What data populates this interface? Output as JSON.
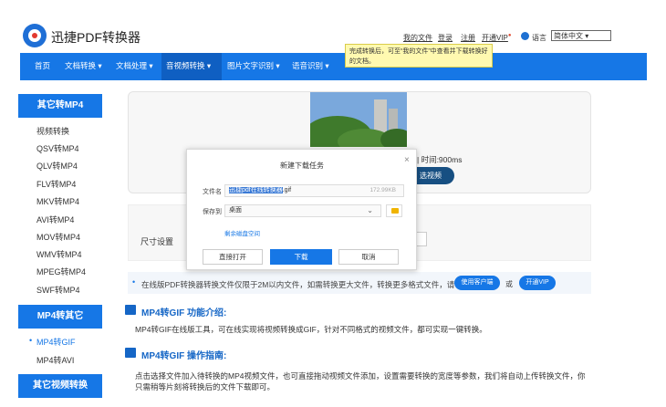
{
  "brand": {
    "name": "迅捷PDF转换器"
  },
  "toplinks": {
    "my_files": "我的文件",
    "login": "登录",
    "register": "注册",
    "open_vip": "开通VIP",
    "vip_badge": "●",
    "language": "语言",
    "lang_value": "简体中文 ▾"
  },
  "tooltip": {
    "text": "完成转换后，可至“我的文件”中查看并下载转换好的文档。"
  },
  "nav": {
    "items": [
      "首页",
      "文档转换 ▾",
      "文档处理 ▾",
      "音视频转换 ▾",
      "图片文字识别 ▾",
      "语音识别 ▾"
    ]
  },
  "sidebar": {
    "section1_title": "其它转MP4",
    "section1_items": [
      "视频转换",
      "QSV转MP4",
      "QLV转MP4",
      "FLV转MP4",
      "MKV转MP4",
      "AVI转MP4",
      "MOV转MP4",
      "WMV转MP4",
      "MPEG转MP4",
      "SWF转MP4"
    ],
    "section2_title": "MP4转其它",
    "section2_items": [
      "MP4转GIF",
      "MP4转AVI"
    ],
    "section3_title": "其它视频转换"
  },
  "preview": {
    "duration": "| 时间:900ms",
    "reselect": "选视频"
  },
  "settings": {
    "size_label": "尺寸设置"
  },
  "info": {
    "text": "在线版PDF转换器转换文件仅限于2M以内文件，如需转换更大文件，转换更多格式文件，请",
    "client_button": "使用客户端",
    "or": "或",
    "vip_button": "开通VIP"
  },
  "intro": {
    "title": "MP4转GIF 功能介绍:",
    "text": "MP4转GIF在线版工具，可在线实现将视频转换成GIF，针对不同格式的视频文件，都可实现一键转换。"
  },
  "guide": {
    "title": "MP4转GIF 操作指南:",
    "line1": "点击选择文件加入待转换的MP4视频文件，也可直接拖动视频文件添加，设置需要转换的宽度等参数，我们将自动上传转换文件，你",
    "line2": "只需稍等片刻将转换后的文件下载即可。"
  },
  "dialog": {
    "title": "新建下载任务",
    "close": "×",
    "filename_label": "文件名",
    "filename_selected": "迅捷pdf在线转换器",
    "filename_ext": ".gif",
    "filesize": "172.99KB",
    "saveto_label": "保存到",
    "saveto_value": "桌面",
    "saveto_arrow": "⌄",
    "remaining_space": "剩余磁盘空间",
    "open_button": "直接打开",
    "download_button": "下载",
    "cancel_button": "取消"
  },
  "colors": {
    "brand_blue": "#1677e6",
    "nav_active": "#0f5fc2",
    "dark_button": "#174f82"
  }
}
